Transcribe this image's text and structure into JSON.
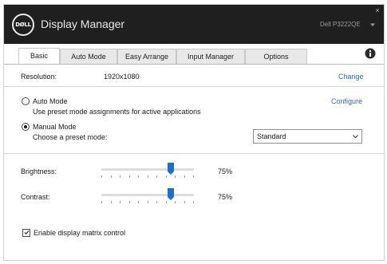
{
  "titlebar": {
    "logo_text": "DØLL",
    "app_title": "Display Manager",
    "monitor_name": "Dell P3222QE",
    "close_glyph": "×"
  },
  "tabs": [
    {
      "label": "Basic",
      "active": true
    },
    {
      "label": "Auto Mode",
      "active": false
    },
    {
      "label": "Easy Arrange",
      "active": false
    },
    {
      "label": "Input Manager",
      "active": false
    },
    {
      "label": "Options",
      "active": false
    }
  ],
  "resolution": {
    "label": "Resolution:",
    "value": "1920x1080",
    "change_link": "Change"
  },
  "auto_mode": {
    "label": "Auto Mode",
    "description": "Use preset mode assignments for active applications",
    "configure_link": "Configure",
    "selected": false
  },
  "manual_mode": {
    "label": "Manual Mode",
    "description": "Choose a preset mode:",
    "selected": true,
    "preset": {
      "selected": "Standard"
    }
  },
  "brightness": {
    "label": "Brightness:",
    "value_text": "75%",
    "value": 0.75
  },
  "contrast": {
    "label": "Contrast:",
    "value_text": "75%",
    "value": 0.75
  },
  "matrix_control": {
    "label": "Enable display matrix control",
    "checked": true
  },
  "icons": {
    "logo": "dell-logo",
    "dropdown": "chevron-down-icon",
    "info": "info-icon",
    "close": "close-icon"
  },
  "colors": {
    "titlebar": "#1f1f1f",
    "link": "#2a6ebb",
    "slider_thumb": "#1f6fc6"
  }
}
